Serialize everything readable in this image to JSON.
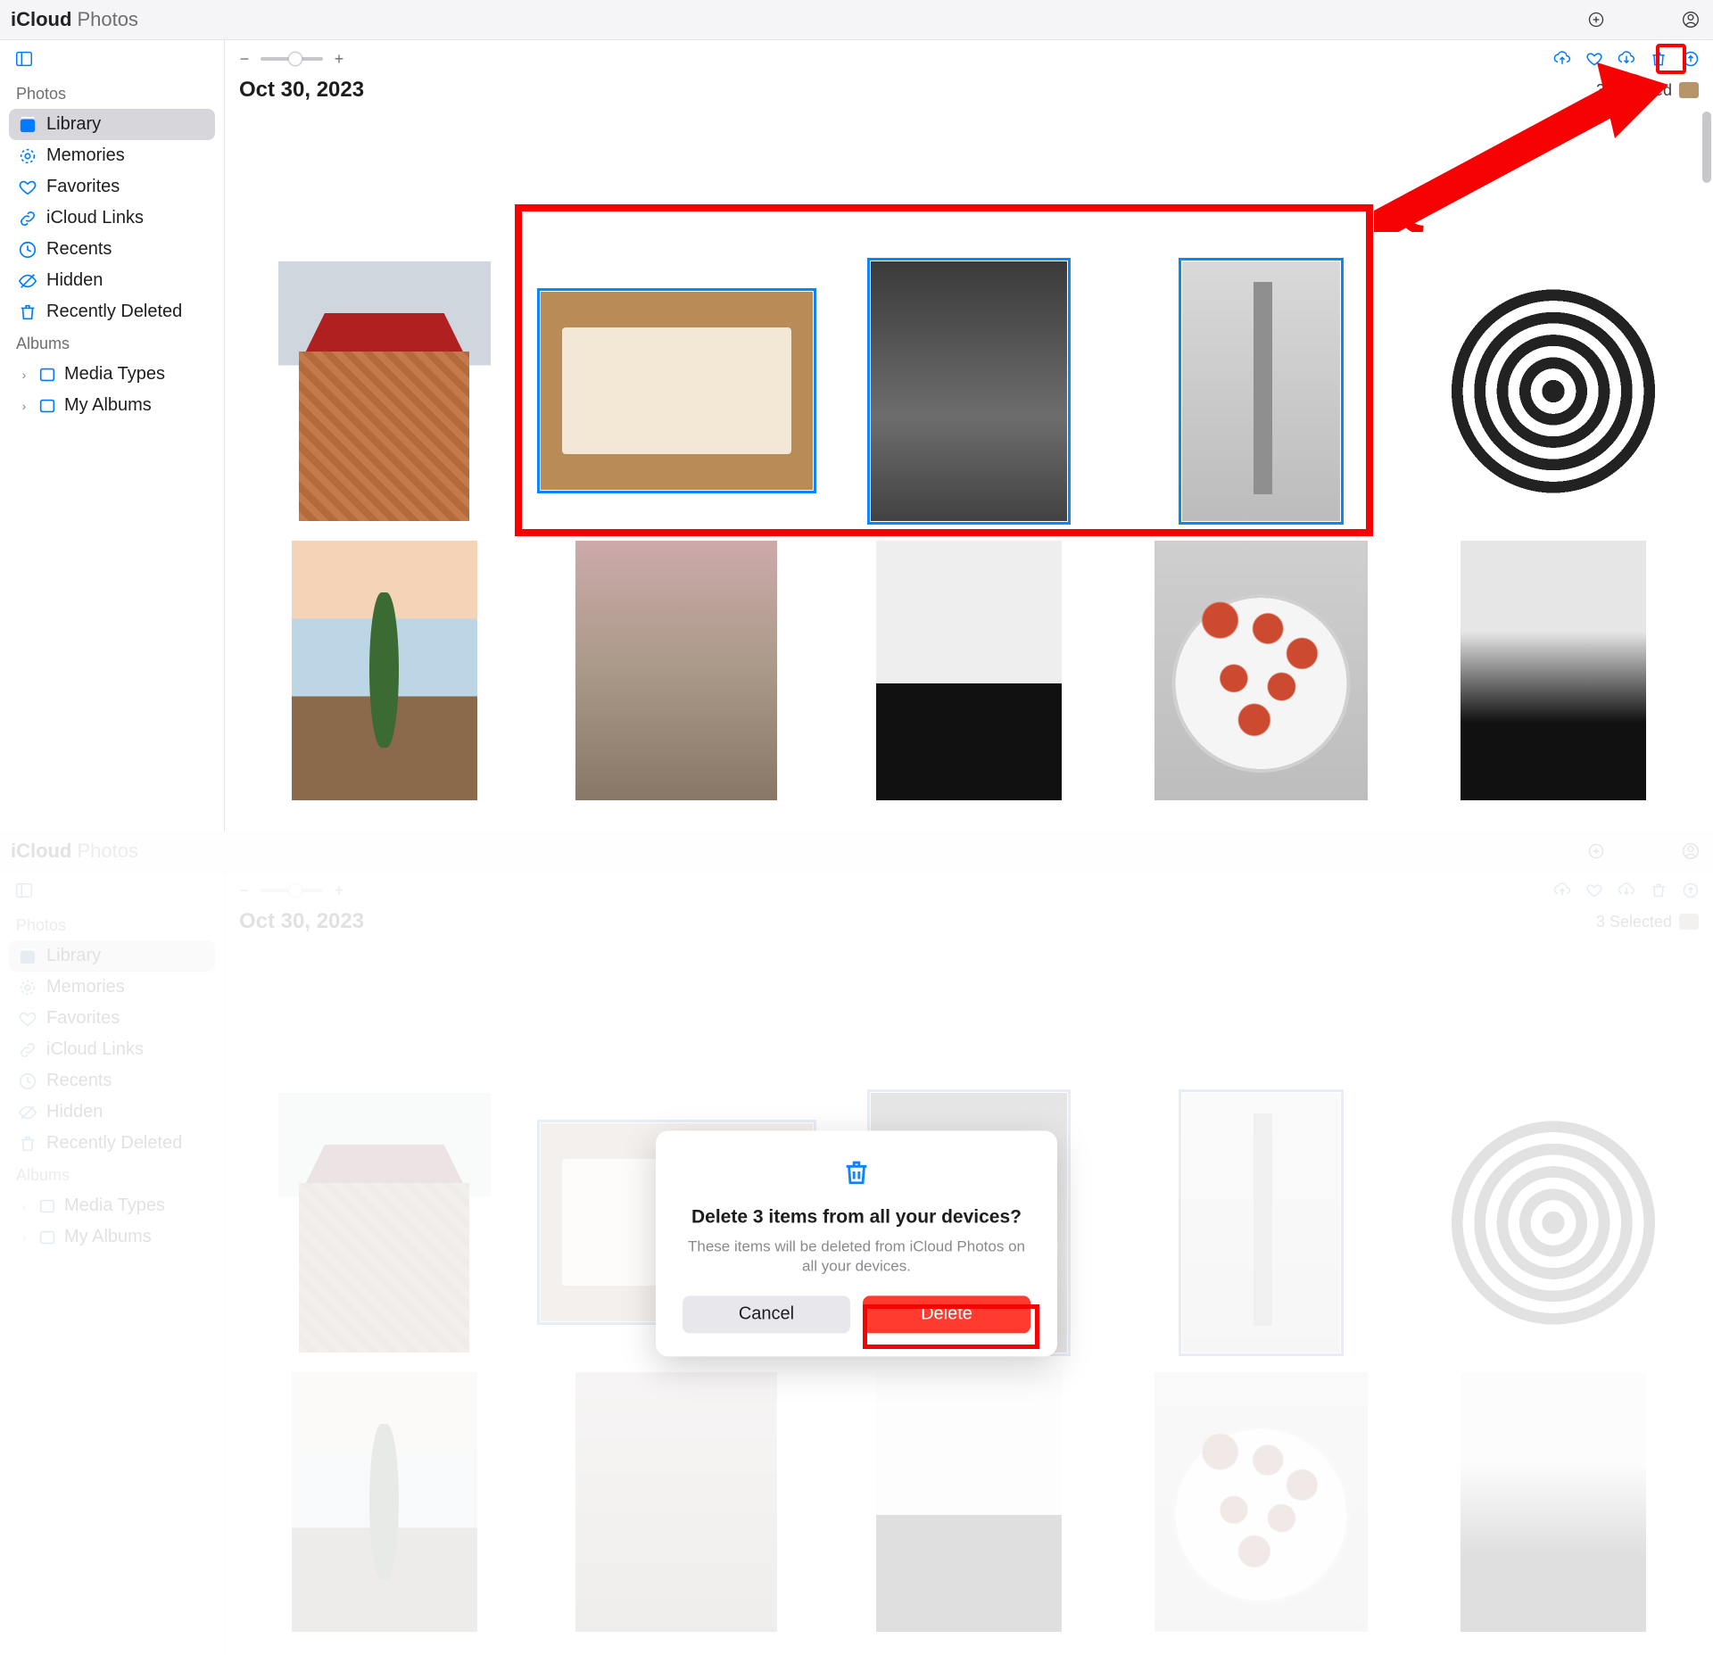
{
  "brand": {
    "strong": "iCloud",
    "light": "Photos"
  },
  "sidebar": {
    "sections": {
      "photos": "Photos",
      "albums": "Albums"
    },
    "items": [
      {
        "label": "Library"
      },
      {
        "label": "Memories"
      },
      {
        "label": "Favorites"
      },
      {
        "label": "iCloud Links"
      },
      {
        "label": "Recents"
      },
      {
        "label": "Hidden"
      },
      {
        "label": "Recently Deleted"
      }
    ],
    "albums": [
      {
        "label": "Media Types"
      },
      {
        "label": "My Albums"
      }
    ]
  },
  "header": {
    "date": "Oct 30, 2023",
    "selected_text": "3 Selected"
  },
  "modal": {
    "title": "Delete 3 items from all your devices?",
    "body": "These items will be deleted from iCloud Photos on all your devices.",
    "cancel": "Cancel",
    "delete": "Delete"
  }
}
